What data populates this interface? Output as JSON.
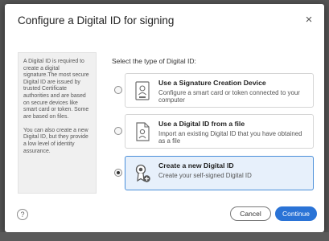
{
  "dialog": {
    "title": "Configure a Digital ID for signing",
    "close_glyph": "×"
  },
  "sidebar": {
    "para1": "A Digital ID is required to create a digital signature.The most secure Digital ID are issued by trusted Certificate authorities and are based on secure devices like smart card or token. Some are based on files.",
    "para2": "You can also create a new Digital ID, but they provide a low level of identity assurance."
  },
  "section_label": "Select the type of Digital ID:",
  "options": [
    {
      "title": "Use a Signature Creation Device",
      "description": "Configure a smart card or token connected to your computer",
      "icon": "signature-device-icon",
      "selected": false
    },
    {
      "title": "Use a Digital ID from a file",
      "description": "Import an existing Digital ID that you have obtained as a file",
      "icon": "digital-id-file-icon",
      "selected": false
    },
    {
      "title": "Create a new Digital ID",
      "description": "Create your self-signed Digital ID",
      "icon": "new-digital-id-icon",
      "selected": true
    }
  ],
  "footer": {
    "help_glyph": "?",
    "cancel_label": "Cancel",
    "continue_label": "Continue"
  },
  "colors": {
    "accent": "#2a73d6",
    "selected_bg": "#e7f0fb",
    "selected_border": "#4a8fd9"
  }
}
